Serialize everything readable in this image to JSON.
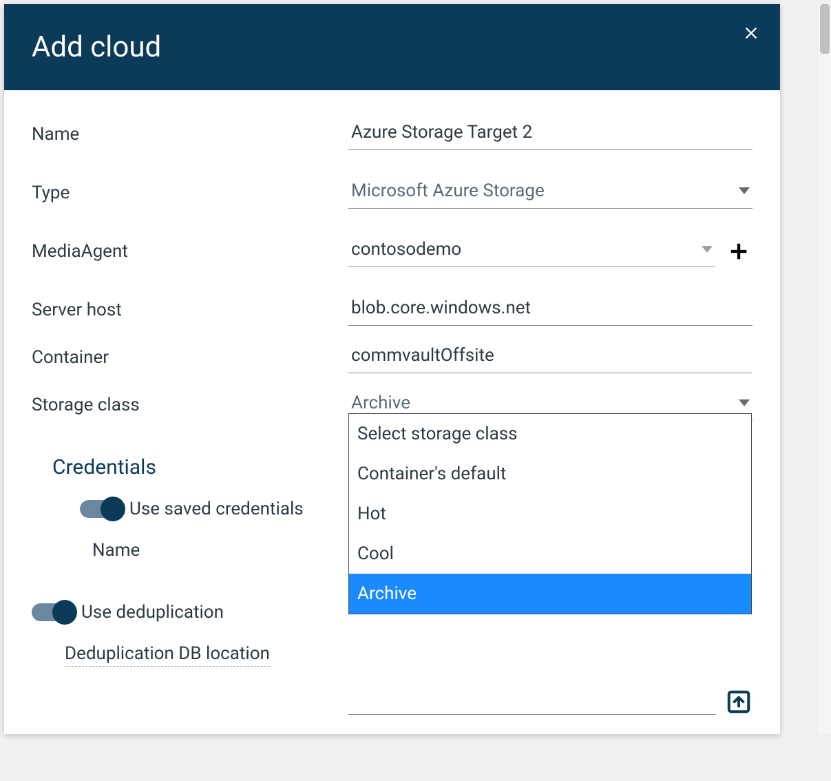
{
  "colors": {
    "header_bg": "#0c3b5a",
    "accent_blue": "#1a8aff"
  },
  "header": {
    "title": "Add cloud"
  },
  "form": {
    "name_label": "Name",
    "name_value": "Azure Storage Target 2",
    "type_label": "Type",
    "type_value": "Microsoft Azure Storage",
    "mediaagent_label": "MediaAgent",
    "mediaagent_value": "contosodemo",
    "serverhost_label": "Server host",
    "serverhost_value": "blob.core.windows.net",
    "container_label": "Container",
    "container_value": "commvaultOffsite",
    "storageclass_label": "Storage class",
    "storageclass_value": "Archive"
  },
  "storage_class_options": [
    {
      "label": "Select storage class"
    },
    {
      "label": "Container's default"
    },
    {
      "label": "Hot"
    },
    {
      "label": "Cool"
    },
    {
      "label": "Archive"
    }
  ],
  "credentials": {
    "section_title": "Credentials",
    "use_saved_label": "Use saved credentials",
    "use_saved_on": true,
    "name_label": "Name"
  },
  "dedup": {
    "use_dedup_label": "Use deduplication",
    "use_dedup_on": true,
    "db_location_label": "Deduplication DB location",
    "db_location_value": ""
  }
}
